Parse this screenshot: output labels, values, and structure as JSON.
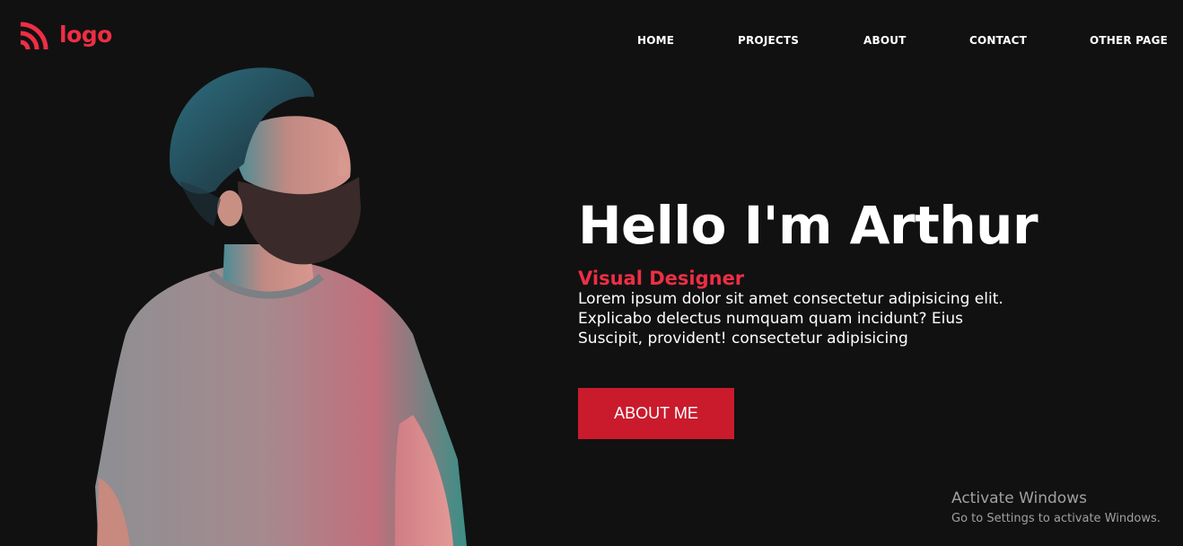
{
  "brand": {
    "logo_text": "logo",
    "accent_color": "#ee2e44",
    "button_color": "#c91b2c",
    "background_color": "#111112",
    "logo_icon": "signal-arcs-icon"
  },
  "nav": {
    "items": [
      {
        "label": "HOME"
      },
      {
        "label": "PROJECTS"
      },
      {
        "label": "ABOUT"
      },
      {
        "label": "CONTACT"
      },
      {
        "label": "OTHER PAGE"
      }
    ]
  },
  "hero": {
    "title": "Hello I'm Arthur",
    "role": "Visual Designer",
    "description_lines": [
      "Lorem ipsum dolor sit amet consectetur adipisicing elit.",
      "Explicabo delectus numquam quam incidunt? Eius",
      "Suscipit, provident! consectetur adipisicing"
    ],
    "button_label": "ABOUT ME",
    "portrait": "bearded-man-looking-up-photo"
  },
  "watermark": {
    "title": "Activate Windows",
    "subtitle": "Go to Settings to activate Windows."
  }
}
